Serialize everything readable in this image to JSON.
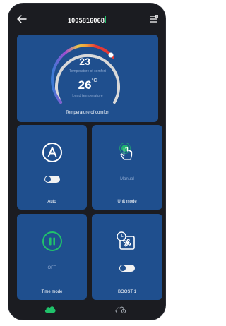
{
  "header": {
    "title": "1005816068"
  },
  "comfort": {
    "comfort_temp": "23",
    "comfort_unit": "°C",
    "comfort_label": "Temperature of comfort",
    "lead_temp": "26",
    "lead_unit": "°C",
    "lead_label": "Lead temperature",
    "card_label": "Temperature of comfort"
  },
  "tiles": {
    "auto": {
      "label": "Auto",
      "icon": "auto-a-icon",
      "toggle_on": false
    },
    "unit_mode": {
      "label": "Unit mode",
      "state": "Manual",
      "icon": "hand-pointer-icon"
    },
    "time_mode": {
      "label": "Time mode",
      "state": "OFF",
      "icon": "pause-icon"
    },
    "boost": {
      "label": "BOOST 1",
      "icon": "boost-fan-icon",
      "toggle_on": false
    }
  },
  "nav": {
    "home_icon": "cloud-icon",
    "settings_icon": "gear-icon"
  },
  "colors": {
    "background": "#1b1c21",
    "card": "#1f4f8e",
    "accent_green": "#20c26b",
    "muted_text": "#8ba7cf"
  }
}
